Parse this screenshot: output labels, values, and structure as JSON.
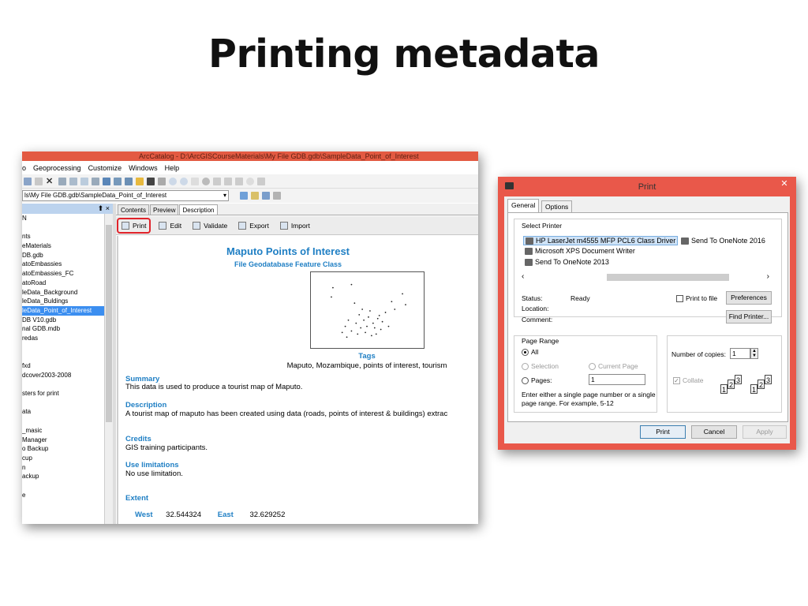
{
  "slide": {
    "title": "Printing metadata"
  },
  "arccatalog": {
    "window_title": "ArcCatalog - D:\\ArcGISCourseMaterials\\My File GDB.gdb\\SampleData_Point_of_Interest",
    "menu": [
      "o",
      "Geoprocessing",
      "Customize",
      "Windows",
      "Help"
    ],
    "location": "ls\\My File GDB.gdb\\SampleData_Point_of_Interest",
    "tree_header": "⬆ ×",
    "tree_items": [
      "N",
      "",
      "nts",
      "eMaterials",
      "DB.gdb",
      "atoEmbassies",
      "atoEmbassies_FC",
      "atoRoad",
      "leData_Background",
      "leData_Buldings",
      "leData_Point_of_Interest",
      "DB V10.gdb",
      "nal GDB.mdb",
      "redas",
      "",
      "",
      "fxd",
      "dcover2003-2008",
      "",
      "sters for print",
      "",
      "ata",
      "",
      "_masic",
      " Manager",
      "o Backup",
      "cup",
      "n",
      "ackup",
      "",
      "e"
    ],
    "selected_tree_item": "leData_Point_of_Interest",
    "tabs": [
      "Contents",
      "Preview",
      "Description"
    ],
    "active_tab": "Description",
    "toolbar": {
      "print": "Print",
      "edit": "Edit",
      "validate": "Validate",
      "export": "Export",
      "import": "Import"
    },
    "doc": {
      "title": "Maputo Points of Interest",
      "subtitle": "File Geodatabase Feature Class",
      "tags_heading": "Tags",
      "tags": "Maputo, Mozambique, points of interest, tourism",
      "summary_heading": "Summary",
      "summary": "This data is used to produce a tourist map of Maputo.",
      "description_heading": "Description",
      "description": "A tourist map of maputo has been created using data (roads, points of interest & buildings) extrac",
      "credits_heading": "Credits",
      "credits": "GIS training participants.",
      "use_limitations_heading": "Use limitations",
      "use_limitations": "No use limitation.",
      "extent_heading": "Extent",
      "extent": {
        "west_label": "West",
        "west": "32.544324",
        "east_label": "East",
        "east": "32.629252"
      }
    }
  },
  "print_dialog": {
    "title": "Print",
    "close": "✕",
    "tabs": [
      "General",
      "Options"
    ],
    "select_printer_label": "Select Printer",
    "printers": [
      "HP LaserJet m4555 MFP PCL6 Class Driver",
      "Send To OneNote 2016",
      "Microsoft XPS Document Writer",
      "Send To OneNote 2013"
    ],
    "selected_printer": "HP LaserJet m4555 MFP PCL6 Class Driver",
    "status_label": "Status:",
    "status": "Ready",
    "location_label": "Location:",
    "comment_label": "Comment:",
    "print_to_file": "Print to file",
    "preferences": "Preferences",
    "find_printer": "Find Printer...",
    "page_range_label": "Page Range",
    "all": "All",
    "selection": "Selection",
    "current_page": "Current Page",
    "pages": "Pages:",
    "pages_value": "1",
    "hint": "Enter either a single page number or a single page range.  For example, 5-12",
    "copies_label": "Number of copies:",
    "copies": "1",
    "collate": "Collate",
    "print_button": "Print",
    "cancel_button": "Cancel",
    "apply_button": "Apply"
  }
}
